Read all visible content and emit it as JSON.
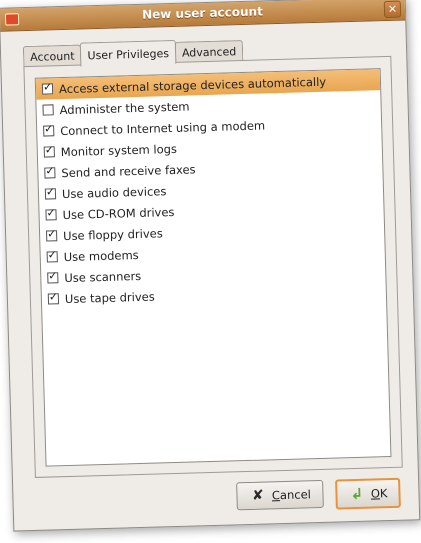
{
  "window": {
    "title": "New user account",
    "close_glyph": "✕"
  },
  "tabs": [
    {
      "label": "Account",
      "active": false
    },
    {
      "label": "User Privileges",
      "active": true
    },
    {
      "label": "Advanced",
      "active": false
    }
  ],
  "privileges": [
    {
      "label": "Access external storage devices automatically",
      "checked": true,
      "selected": true
    },
    {
      "label": "Administer the system",
      "checked": false,
      "selected": false
    },
    {
      "label": "Connect to Internet using a modem",
      "checked": true,
      "selected": false
    },
    {
      "label": "Monitor system logs",
      "checked": true,
      "selected": false
    },
    {
      "label": "Send and receive faxes",
      "checked": true,
      "selected": false
    },
    {
      "label": "Use audio devices",
      "checked": true,
      "selected": false
    },
    {
      "label": "Use CD-ROM drives",
      "checked": true,
      "selected": false
    },
    {
      "label": "Use floppy drives",
      "checked": true,
      "selected": false
    },
    {
      "label": "Use modems",
      "checked": true,
      "selected": false
    },
    {
      "label": "Use scanners",
      "checked": true,
      "selected": false
    },
    {
      "label": "Use tape drives",
      "checked": true,
      "selected": false
    }
  ],
  "buttons": {
    "cancel": {
      "mnemonic": "C",
      "rest": "ancel",
      "icon": "cancel-x-icon"
    },
    "ok": {
      "mnemonic": "O",
      "rest": "K",
      "icon": "ok-arrow-icon"
    }
  },
  "colors": {
    "titlebar": "#c48d4f",
    "selection": "#eeb062",
    "ok_border": "#e7933e"
  }
}
